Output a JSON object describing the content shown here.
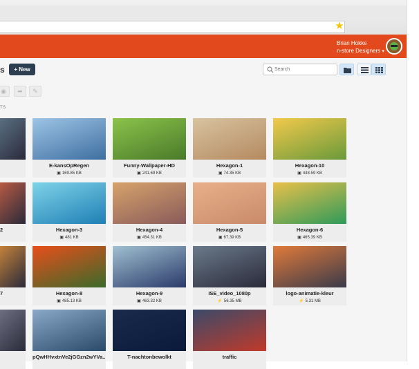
{
  "browser": {
    "star_icon": "star-icon"
  },
  "header": {
    "user_name": "Brian Hokke",
    "org_name": "n-store Designers",
    "accent": "#e2491d"
  },
  "toolbar": {
    "title_fragment": "s",
    "new_label": "+ New",
    "search_placeholder": "Search"
  },
  "section_label_fragment": "TS",
  "edge_items": [
    {
      "name": "",
      "color": "#5a6f83"
    },
    {
      "name": "2",
      "color": "#b85a44"
    },
    {
      "name": "7",
      "color": "#c4823a"
    },
    {
      "name": "",
      "color": "#6d6f80"
    }
  ],
  "files": [
    {
      "name": "E-kansOpRegen",
      "size": "169.85 KB",
      "type": "image",
      "c1": "#9ec4e6",
      "c2": "#3e6fa0"
    },
    {
      "name": "Funny-Wallpaper-HD",
      "size": "241.69 KB",
      "type": "image",
      "c1": "#8bc34a",
      "c2": "#4a7a2a"
    },
    {
      "name": "Hexagon-1",
      "size": "74.35 KB",
      "type": "image",
      "c1": "#d7c3a0",
      "c2": "#b58a60"
    },
    {
      "name": "Hexagon-10",
      "size": "448.59 KB",
      "type": "image",
      "c1": "#f2c94c",
      "c2": "#6a9a3a"
    },
    {
      "name": "Hexagon-3",
      "size": "481 KB",
      "type": "image",
      "c1": "#7fd3e8",
      "c2": "#1f7fb5"
    },
    {
      "name": "Hexagon-4",
      "size": "454.31 KB",
      "type": "image",
      "c1": "#d6a36b",
      "c2": "#8a5a5a"
    },
    {
      "name": "Hexagon-5",
      "size": "67.39 KB",
      "type": "image",
      "c1": "#e8b08a",
      "c2": "#c98a6a"
    },
    {
      "name": "Hexagon-6",
      "size": "465.39 KB",
      "type": "image",
      "c1": "#e9c04a",
      "c2": "#2f9a5a"
    },
    {
      "name": "Hexagon-8",
      "size": "485.13 KB",
      "type": "image",
      "c1": "#e94e1b",
      "c2": "#3a6a2a"
    },
    {
      "name": "Hexagon-9",
      "size": "463.32 KB",
      "type": "image",
      "c1": "#a0c0d0",
      "c2": "#2a3a6a"
    },
    {
      "name": "ISE_video_1080p",
      "size": "56.35 MB",
      "type": "video",
      "c1": "#6a7a8a",
      "c2": "#2a2a3a"
    },
    {
      "name": "logo-animatie-kleur",
      "size": "5.31 MB",
      "type": "video",
      "c1": "#e07a3a",
      "c2": "#3a3a4a"
    },
    {
      "name": "pQwHHvxtnVe2jGGzn2wYVa...",
      "size": "",
      "type": "image",
      "c1": "#8aa8c8",
      "c2": "#2a4a6a"
    },
    {
      "name": "T-nachtonbewolkt",
      "size": "",
      "type": "image",
      "c1": "#1a2a4a",
      "c2": "#0a1a3a"
    },
    {
      "name": "traffic",
      "size": "",
      "type": "image",
      "c1": "#3a4a6a",
      "c2": "#c03a2a"
    }
  ]
}
